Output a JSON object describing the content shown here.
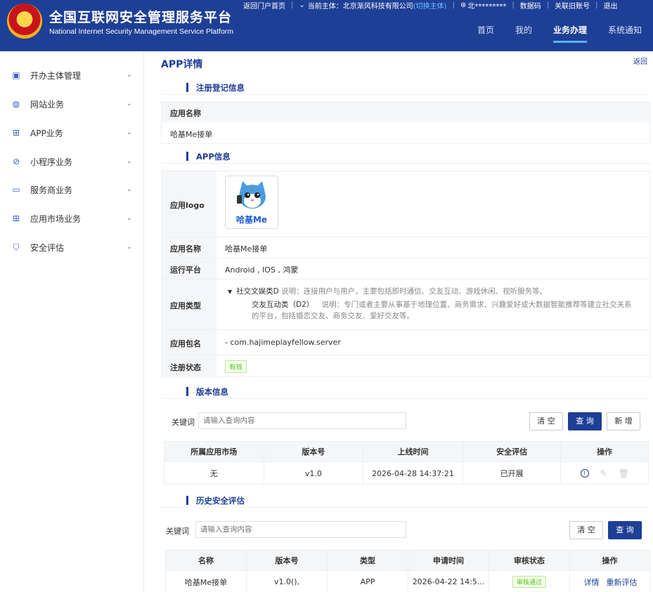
{
  "header": {
    "title": "全国互联网安全管理服务平台",
    "subtitle": "National Internet Security Management Service Platform",
    "topbar": {
      "back_portal": "返回门户首页",
      "subject_label": "当前主体：北京渐风科技有限公司",
      "switch_subject": "(切换主体)",
      "user": "北*********",
      "digital_code": "数据码",
      "link_old_account": "关联旧账号",
      "logout": "退出"
    },
    "nav": [
      "首页",
      "我的",
      "业务办理",
      "系统通知"
    ],
    "active_nav": "业务办理"
  },
  "sidebar": {
    "items": [
      {
        "label": "开办主体管理",
        "icon": "briefcase-icon"
      },
      {
        "label": "网站业务",
        "icon": "globe-icon"
      },
      {
        "label": "APP业务",
        "icon": "grid-icon"
      },
      {
        "label": "小程序业务",
        "icon": "compass-icon"
      },
      {
        "label": "服务商业务",
        "icon": "monitor-icon"
      },
      {
        "label": "应用市场业务",
        "icon": "grid-icon"
      },
      {
        "label": "安全评估",
        "icon": "shield-icon"
      }
    ]
  },
  "page": {
    "title": "APP详情",
    "back": "返回"
  },
  "registration": {
    "section_title": "注册登记信息",
    "header": "应用名称",
    "value": "哈基Me接单"
  },
  "app_info": {
    "section_title": "APP信息",
    "logo_label": "应用logo",
    "logo_text": "哈基Me",
    "name_label": "应用名称",
    "name_value": "哈基Me接单",
    "platform_label": "运行平台",
    "platform_value": "Android , IOS , 鸿蒙",
    "type_label": "应用类型",
    "type_category": "社交文娱类D",
    "type_category_note_label": "说明：",
    "type_category_note": "连接用户与用户，主要包括即时通信、交友互动、游戏休闲、视听服务等。",
    "type_sub": "交友互动类（D2）",
    "type_sub_note_label": "说明：",
    "type_sub_note_line1": "专门或者主要从事基于地理位置、商务需求、兴趣爱好或大数据智能推荐等建立社交关系",
    "type_sub_note_line2": "的平台，包括婚恋交友、商务交友、爱好交友等。",
    "package_label": "应用包名",
    "package_value": "- com.hajimeplayfellow.server",
    "status_label": "注册状态",
    "status_value": "有效"
  },
  "versions": {
    "section_title": "版本信息",
    "keyword_label": "关键词",
    "placeholder": "请输入查询内容",
    "clear": "清 空",
    "query": "查 询",
    "add": "新 增",
    "columns": [
      "所属应用市场",
      "版本号",
      "上线时间",
      "安全评估",
      "操作"
    ],
    "rows": [
      {
        "market": "无",
        "version": "v1.0",
        "online_time": "2026-04-28 14:37:21",
        "assessment": "已开展"
      }
    ]
  },
  "history": {
    "section_title": "历史安全评估",
    "keyword_label": "关键词",
    "placeholder": "请输入查询内容",
    "clear": "清 空",
    "query": "查 询",
    "columns": [
      "名称",
      "版本号",
      "类型",
      "申请时间",
      "审核状态",
      "操作"
    ],
    "rows": [
      {
        "name": "哈基Me接单",
        "version": "v1.0(),",
        "type": "APP",
        "apply_time": "2026-04-22 14:5...",
        "status": "审核通过",
        "detail": "详情",
        "reassess": "重新评估"
      }
    ]
  },
  "colors": {
    "brand": "#1e3f96",
    "accent": "#5ab0ff",
    "success": "#52c41a"
  }
}
